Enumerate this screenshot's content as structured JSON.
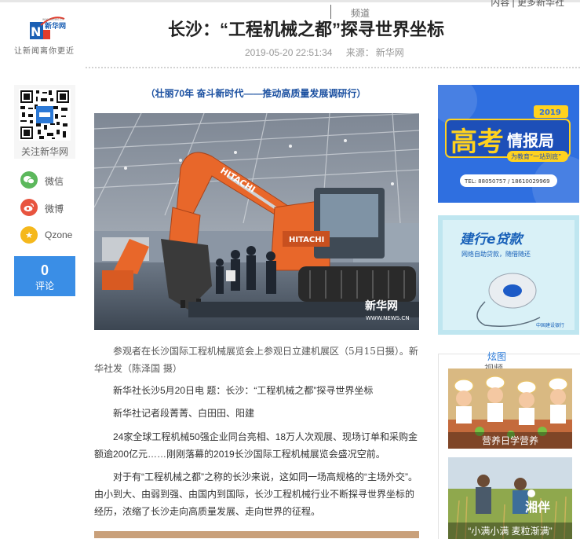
{
  "header": {
    "logo_text": "新华网",
    "logo_url_small": "www.news.cn",
    "tagline": "让新闻离你更近",
    "channel_label": "频道",
    "top_nav": "内容 | 更多新华社",
    "title": "长沙：“工程机械之都”探寻世界坐标",
    "datetime": "2019-05-20 22:51:34",
    "source_label": "来源：",
    "source": "新华网"
  },
  "left_sidebar": {
    "qr_label": "关注新华网",
    "share": [
      {
        "label": "微信",
        "icon": "wechat-icon",
        "color": "#5cb85c"
      },
      {
        "label": "微博",
        "icon": "weibo-icon",
        "color": "#e8543f"
      },
      {
        "label": "Qzone",
        "icon": "qzone-icon",
        "color": "#f5b81c"
      }
    ],
    "comment_count": "0",
    "comment_label": "评论"
  },
  "article": {
    "series": "（壮丽70年 奋斗新时代——推动高质量发展调研行）",
    "photo_watermark": "新华网",
    "photo_watermark_url": "WWW.NEWS.CN",
    "photo_brand": "HITACHI",
    "caption": "参观者在长沙国际工程机械展览会上参观日立建机展区（5月15日摄）。新华社发（陈泽国 摄）",
    "paragraphs": [
      "新华社长沙5月20日电 题：长沙：“工程机械之都”探寻世界坐标",
      "新华社记者段菁菁、白田田、阳建",
      "24家全球工程机械50强企业同台亮相、18万人次观展、现场订单和采购金额逾200亿元……刚刚落幕的2019长沙国际工程机械展览会盛况空前。",
      "对于有“工程机械之都”之称的长沙来说，这如同一场高规格的“主场外交”。由小到大、由弱到强、由国内到国际，长沙工程机械行业不断探寻世界坐标的经历，浓缩了长沙走向高质量发展、走向世界的征程。"
    ]
  },
  "right_sidebar": {
    "ad1": {
      "year": "2019",
      "title_a": "高考",
      "title_b": "情报局",
      "slogan": "为教育“一站到底”",
      "phone": "TEL: 88050757 / 18610029969",
      "colors": {
        "bg": "#2f6fe0",
        "accent": "#ffd21f"
      }
    },
    "ad2": {
      "title": "建行e贷款",
      "subtitle": "网络自助贷款，随借随还",
      "bank": "中国建设银行",
      "colors": {
        "bg": "#bfe6f0",
        "accent": "#1760b8"
      }
    },
    "gallery": {
      "tab_active": "炫图",
      "tab_other": "视频",
      "items": [
        {
          "caption": "营养日学营养"
        },
        {
          "caption": "“小满小满 麦粒渐满”",
          "overlay": "湘伴"
        }
      ]
    }
  }
}
